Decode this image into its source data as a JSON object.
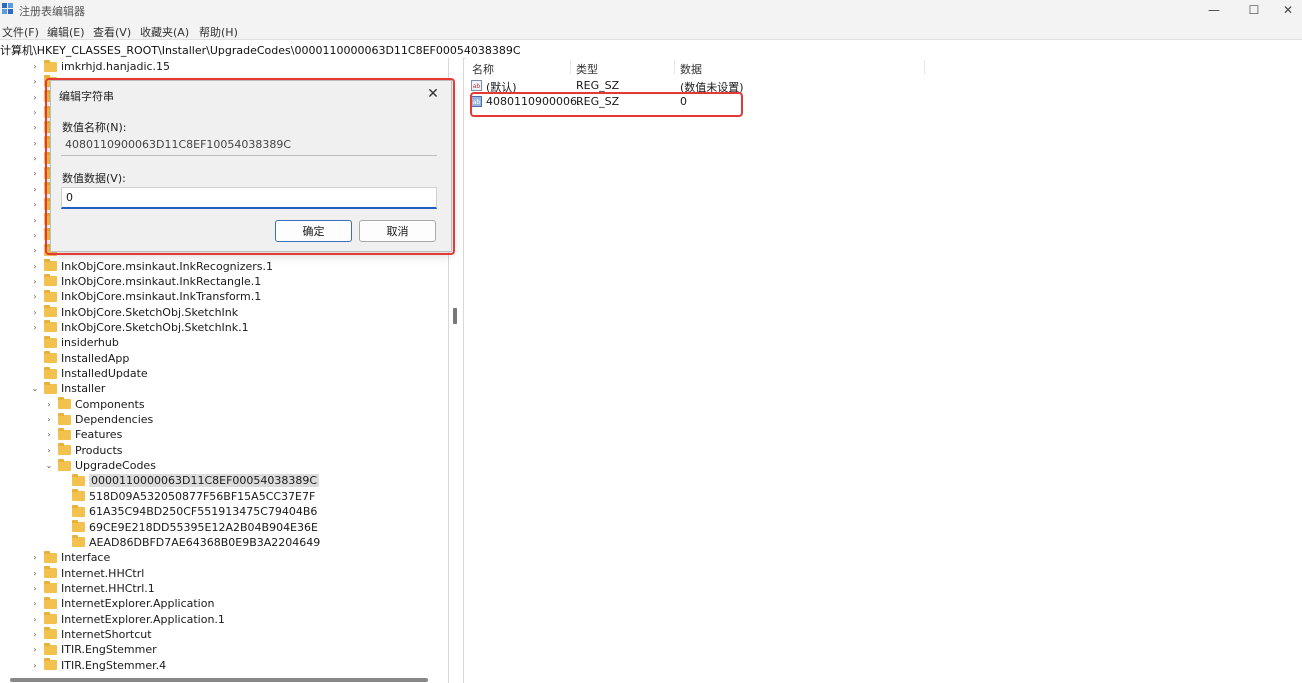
{
  "window": {
    "title": "注册表编辑器",
    "min_glyph": "—",
    "max_glyph": "☐",
    "close_glyph": "✕"
  },
  "menu": [
    "文件(F)",
    "编辑(E)",
    "查看(V)",
    "收藏夹(A)",
    "帮助(H)"
  ],
  "address": "计算机\\HKEY_CLASSES_ROOT\\Installer\\UpgradeCodes\\0000110000063D11C8EF00054038389C",
  "tree": [
    {
      "label": "imkrhjd.hanjadic.15",
      "indent": 0,
      "twisty": "›"
    },
    {
      "label": "",
      "indent": 0,
      "twisty": "›"
    },
    {
      "label": "",
      "indent": 0,
      "twisty": "›"
    },
    {
      "label": "",
      "indent": 0,
      "twisty": "›"
    },
    {
      "label": "",
      "indent": 0,
      "twisty": "›"
    },
    {
      "label": "",
      "indent": 0,
      "twisty": "›"
    },
    {
      "label": "",
      "indent": 0,
      "twisty": "›"
    },
    {
      "label": "",
      "indent": 0,
      "twisty": "›"
    },
    {
      "label": "",
      "indent": 0,
      "twisty": "›"
    },
    {
      "label": "",
      "indent": 0,
      "twisty": "›"
    },
    {
      "label": "",
      "indent": 0,
      "twisty": "›"
    },
    {
      "label": "",
      "indent": 0,
      "twisty": "›"
    },
    {
      "label": "",
      "indent": 0,
      "twisty": "›"
    },
    {
      "label": "InkObjCore.msinkaut.InkRecognizers.1",
      "indent": 0,
      "twisty": "›"
    },
    {
      "label": "InkObjCore.msinkaut.InkRectangle.1",
      "indent": 0,
      "twisty": "›"
    },
    {
      "label": "InkObjCore.msinkaut.InkTransform.1",
      "indent": 0,
      "twisty": "›"
    },
    {
      "label": "InkObjCore.SketchObj.SketchInk",
      "indent": 0,
      "twisty": "›"
    },
    {
      "label": "InkObjCore.SketchObj.SketchInk.1",
      "indent": 0,
      "twisty": "›"
    },
    {
      "label": "insiderhub",
      "indent": 0,
      "twisty": ""
    },
    {
      "label": "InstalledApp",
      "indent": 0,
      "twisty": ""
    },
    {
      "label": "InstalledUpdate",
      "indent": 0,
      "twisty": ""
    },
    {
      "label": "Installer",
      "indent": 0,
      "twisty": "⌄"
    },
    {
      "label": "Components",
      "indent": 1,
      "twisty": "›"
    },
    {
      "label": "Dependencies",
      "indent": 1,
      "twisty": "›"
    },
    {
      "label": "Features",
      "indent": 1,
      "twisty": "›"
    },
    {
      "label": "Products",
      "indent": 1,
      "twisty": "›"
    },
    {
      "label": "UpgradeCodes",
      "indent": 1,
      "twisty": "⌄"
    },
    {
      "label": "0000110000063D11C8EF00054038389C",
      "indent": 2,
      "twisty": "",
      "selected": true
    },
    {
      "label": "518D09A532050877F56BF15A5CC37E7F",
      "indent": 2,
      "twisty": ""
    },
    {
      "label": "61A35C94BD250CF551913475C79404B6",
      "indent": 2,
      "twisty": ""
    },
    {
      "label": "69CE9E218DD55395E12A2B04B904E36E",
      "indent": 2,
      "twisty": ""
    },
    {
      "label": "AEAD86DBFD7AE64368B0E9B3A2204649",
      "indent": 2,
      "twisty": ""
    },
    {
      "label": "Interface",
      "indent": 0,
      "twisty": "›"
    },
    {
      "label": "Internet.HHCtrl",
      "indent": 0,
      "twisty": "›"
    },
    {
      "label": "Internet.HHCtrl.1",
      "indent": 0,
      "twisty": "›"
    },
    {
      "label": "InternetExplorer.Application",
      "indent": 0,
      "twisty": "›"
    },
    {
      "label": "InternetExplorer.Application.1",
      "indent": 0,
      "twisty": "›"
    },
    {
      "label": "InternetShortcut",
      "indent": 0,
      "twisty": "›"
    },
    {
      "label": "ITIR.EngStemmer",
      "indent": 0,
      "twisty": "›"
    },
    {
      "label": "ITIR.EngStemmer.4",
      "indent": 0,
      "twisty": "›"
    }
  ],
  "list": {
    "headers": {
      "name": "名称",
      "type": "类型",
      "data": "数据"
    },
    "rows": [
      {
        "icon": "ab",
        "name": "(默认)",
        "type": "REG_SZ",
        "data": "(数值未设置)"
      },
      {
        "icon": "ab",
        "name": "4080110900006...",
        "type": "REG_SZ",
        "data": "0"
      }
    ]
  },
  "dialog": {
    "title": "编辑字符串",
    "name_label": "数值名称(N):",
    "name_value": "4080110900063D11C8EF10054038389C",
    "data_label": "数值数据(V):",
    "data_value": "0",
    "ok": "确定",
    "cancel": "取消"
  },
  "colors": {
    "highlight_frame": "#e53935",
    "folder": "#f2c14e"
  }
}
